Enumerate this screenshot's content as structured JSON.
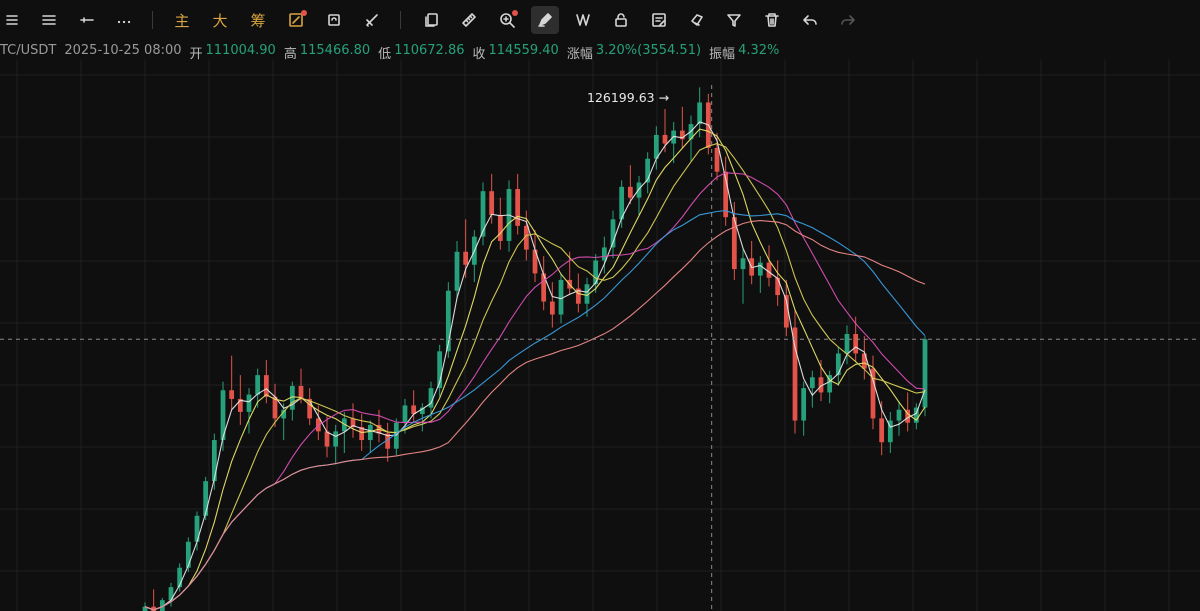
{
  "toolbar": {
    "items": [
      {
        "name": "menu-alt-icon"
      },
      {
        "name": "menu-icon"
      },
      {
        "name": "horizontal-line-icon"
      },
      {
        "name": "more-icon"
      },
      {
        "name": "main-indicator-button",
        "label": "主"
      },
      {
        "name": "large-button",
        "label": "大"
      },
      {
        "name": "chips-button",
        "label": "筹"
      },
      {
        "name": "draw-tool-icon"
      },
      {
        "name": "refresh-icon"
      },
      {
        "name": "scissors-icon"
      },
      {
        "name": "copy-icon"
      },
      {
        "name": "ruler-icon"
      },
      {
        "name": "zoom-icon"
      },
      {
        "name": "pen-icon"
      },
      {
        "name": "pattern-icon"
      },
      {
        "name": "lock-icon"
      },
      {
        "name": "note-icon"
      },
      {
        "name": "magnet-icon"
      },
      {
        "name": "filter-icon"
      },
      {
        "name": "trash-icon"
      },
      {
        "name": "undo-icon"
      },
      {
        "name": "redo-icon"
      }
    ]
  },
  "ohlc": {
    "symbol": "TC/USDT",
    "timestamp": "2025-10-25 08:00",
    "open_label": "开",
    "open": "111004.90",
    "high_label": "高",
    "high": "115466.80",
    "low_label": "低",
    "low": "110672.86",
    "close_label": "收",
    "close": "114559.40",
    "change_label": "涨幅",
    "change": "3.20%(3554.51)",
    "amp_label": "振幅",
    "amp": "4.32%"
  },
  "peak": {
    "label": "126199.63 →"
  },
  "colors": {
    "up": "#26a17b",
    "down": "#e2534a",
    "ma_white": "#e6e6e6",
    "ma_yellow": "#e8e36a",
    "ma_yellow2": "#d8cf55",
    "ma_magenta": "#d94fb6",
    "ma_blue": "#3b9fe0",
    "ma_pink": "#f08a8a"
  },
  "chart_data": {
    "type": "candlestick",
    "y_range": [
      102000,
      127000
    ],
    "candles": [
      [
        101800,
        102400,
        101200,
        102200
      ],
      [
        102200,
        103000,
        101700,
        101900
      ],
      [
        101900,
        102600,
        101400,
        102500
      ],
      [
        102500,
        103300,
        102200,
        103100
      ],
      [
        103100,
        104200,
        102900,
        104000
      ],
      [
        104000,
        105400,
        103800,
        105200
      ],
      [
        105200,
        106600,
        104800,
        106400
      ],
      [
        106400,
        108200,
        106200,
        108000
      ],
      [
        108000,
        110200,
        107600,
        109900
      ],
      [
        109900,
        112600,
        109400,
        112200
      ],
      [
        112200,
        113800,
        111300,
        111800
      ],
      [
        111800,
        112900,
        110600,
        111200
      ],
      [
        111200,
        112300,
        110200,
        112000
      ],
      [
        112000,
        113200,
        111400,
        112900
      ],
      [
        112900,
        113600,
        111600,
        111900
      ],
      [
        111900,
        112500,
        110500,
        110900
      ],
      [
        110900,
        111600,
        109900,
        111300
      ],
      [
        111300,
        112600,
        110800,
        112400
      ],
      [
        112400,
        113200,
        111600,
        111800
      ],
      [
        111800,
        112300,
        110600,
        110900
      ],
      [
        110900,
        111500,
        109900,
        110300
      ],
      [
        110300,
        111000,
        109100,
        109600
      ],
      [
        109600,
        110600,
        108800,
        110300
      ],
      [
        110300,
        111200,
        109300,
        110900
      ],
      [
        110900,
        111600,
        110000,
        110500
      ],
      [
        110500,
        111100,
        109400,
        109900
      ],
      [
        109900,
        110800,
        109300,
        110600
      ],
      [
        110600,
        111300,
        109800,
        110200
      ],
      [
        110200,
        110700,
        108900,
        109500
      ],
      [
        109500,
        110900,
        109200,
        110700
      ],
      [
        110700,
        111800,
        110200,
        111500
      ],
      [
        111500,
        112200,
        110700,
        111100
      ],
      [
        111100,
        111600,
        110300,
        111400
      ],
      [
        111400,
        112600,
        110900,
        112300
      ],
      [
        112300,
        114300,
        111900,
        114000
      ],
      [
        114000,
        117200,
        113700,
        116800
      ],
      [
        116800,
        119100,
        116400,
        118600
      ],
      [
        118600,
        120100,
        117400,
        118000
      ],
      [
        118000,
        119600,
        117200,
        119300
      ],
      [
        119300,
        121800,
        118900,
        121400
      ],
      [
        121400,
        122200,
        119900,
        120300
      ],
      [
        120300,
        121100,
        118700,
        119100
      ],
      [
        119100,
        121900,
        118600,
        121500
      ],
      [
        121500,
        122200,
        119400,
        119800
      ],
      [
        119800,
        120500,
        118200,
        118700
      ],
      [
        118700,
        119600,
        117200,
        117600
      ],
      [
        117600,
        118400,
        115900,
        116300
      ],
      [
        116300,
        117200,
        115100,
        115700
      ],
      [
        115700,
        117600,
        115300,
        117300
      ],
      [
        117300,
        118600,
        116600,
        116900
      ],
      [
        116900,
        117600,
        115800,
        116200
      ],
      [
        116200,
        117400,
        115600,
        117100
      ],
      [
        117100,
        118500,
        116700,
        118200
      ],
      [
        118200,
        119300,
        117600,
        118800
      ],
      [
        118800,
        120500,
        118300,
        120100
      ],
      [
        120100,
        121900,
        119700,
        121600
      ],
      [
        121600,
        122600,
        120800,
        121100
      ],
      [
        121100,
        122100,
        120300,
        121800
      ],
      [
        121800,
        123200,
        121300,
        122900
      ],
      [
        122900,
        124400,
        122400,
        124000
      ],
      [
        124000,
        125200,
        123200,
        123600
      ],
      [
        123600,
        124600,
        122700,
        124200
      ],
      [
        124200,
        125300,
        123400,
        123800
      ],
      [
        123800,
        124900,
        122800,
        124500
      ],
      [
        124500,
        126199,
        123900,
        125500
      ],
      [
        125500,
        125900,
        123100,
        123400
      ],
      [
        123400,
        124100,
        121900,
        122300
      ],
      [
        122300,
        123000,
        119800,
        120200
      ],
      [
        120200,
        120900,
        117300,
        117800
      ],
      [
        117800,
        118700,
        116200,
        118300
      ],
      [
        118300,
        119100,
        117100,
        117500
      ],
      [
        117500,
        118400,
        116700,
        118100
      ],
      [
        118100,
        118900,
        117000,
        117400
      ],
      [
        117400,
        118200,
        116100,
        116600
      ],
      [
        116600,
        117300,
        114700,
        115100
      ],
      [
        115100,
        115900,
        110200,
        110800
      ],
      [
        110800,
        112600,
        110100,
        112300
      ],
      [
        112300,
        113100,
        111400,
        112800
      ],
      [
        112800,
        113600,
        111700,
        112100
      ],
      [
        112100,
        113100,
        111600,
        112900
      ],
      [
        112900,
        114200,
        112400,
        113900
      ],
      [
        113900,
        115200,
        113400,
        114800
      ],
      [
        114800,
        115600,
        113500,
        113900
      ],
      [
        113900,
        114700,
        112700,
        113200
      ],
      [
        113200,
        113800,
        110400,
        110900
      ],
      [
        110900,
        111700,
        109200,
        109800
      ],
      [
        109800,
        111200,
        109300,
        110800
      ],
      [
        110800,
        111700,
        110100,
        111300
      ],
      [
        111300,
        112100,
        110300,
        110700
      ],
      [
        110700,
        111600,
        110400,
        111400
      ],
      [
        111400,
        114700,
        111000,
        114559
      ]
    ]
  }
}
